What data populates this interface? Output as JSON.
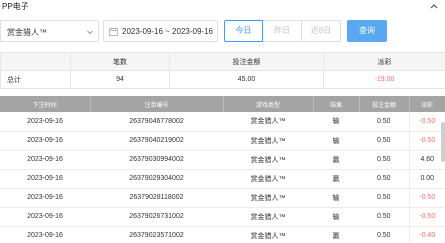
{
  "header": {
    "title": "PP电子"
  },
  "filters": {
    "game_select": "赏金猎人™",
    "date_range": "2023-09-16 ~ 2023-09-16",
    "quick_ranges": [
      "今日",
      "昨日",
      "近8日"
    ],
    "search_label": "查询"
  },
  "summary": {
    "headers": [
      "",
      "笔数",
      "投注金额",
      "派彩"
    ],
    "total_label": "总计",
    "count": "94",
    "bet_amount": "45.00",
    "payout": "-19.00"
  },
  "details": {
    "headers": [
      "下注时间",
      "注单编号",
      "游戏类型",
      "结果",
      "投注金额",
      "派彩"
    ],
    "rows": [
      {
        "time": "2023-09-16",
        "id": "26379046778002",
        "game": "赏金猎人™",
        "result": "输",
        "bet": "0.50",
        "payout": "-0.50"
      },
      {
        "time": "2023-09-16",
        "id": "26379040219002",
        "game": "赏金猎人™",
        "result": "输",
        "bet": "0.50",
        "payout": "-0.50"
      },
      {
        "time": "2023-09-16",
        "id": "26379030994002",
        "game": "赏金猎人™",
        "result": "赢",
        "bet": "0.50",
        "payout": "4.60"
      },
      {
        "time": "2023-09-16",
        "id": "26379029304002",
        "game": "赏金猎人™",
        "result": "赢",
        "bet": "0.50",
        "payout": "0.00"
      },
      {
        "time": "2023-09-16",
        "id": "26379028118002",
        "game": "赏金猎人™",
        "result": "输",
        "bet": "0.50",
        "payout": "-0.50"
      },
      {
        "time": "2023-09-16",
        "id": "26379026731002",
        "game": "赏金猎人™",
        "result": "输",
        "bet": "0.50",
        "payout": "-0.50"
      },
      {
        "time": "2023-09-16",
        "id": "26379023571002",
        "game": "赏金猎人™",
        "result": "赢",
        "bet": "0.50",
        "payout": "-0.40"
      }
    ]
  },
  "colors": {
    "accent": "#409eff",
    "negative": "#f56c6c",
    "header_bg": "#a4a4a4"
  }
}
